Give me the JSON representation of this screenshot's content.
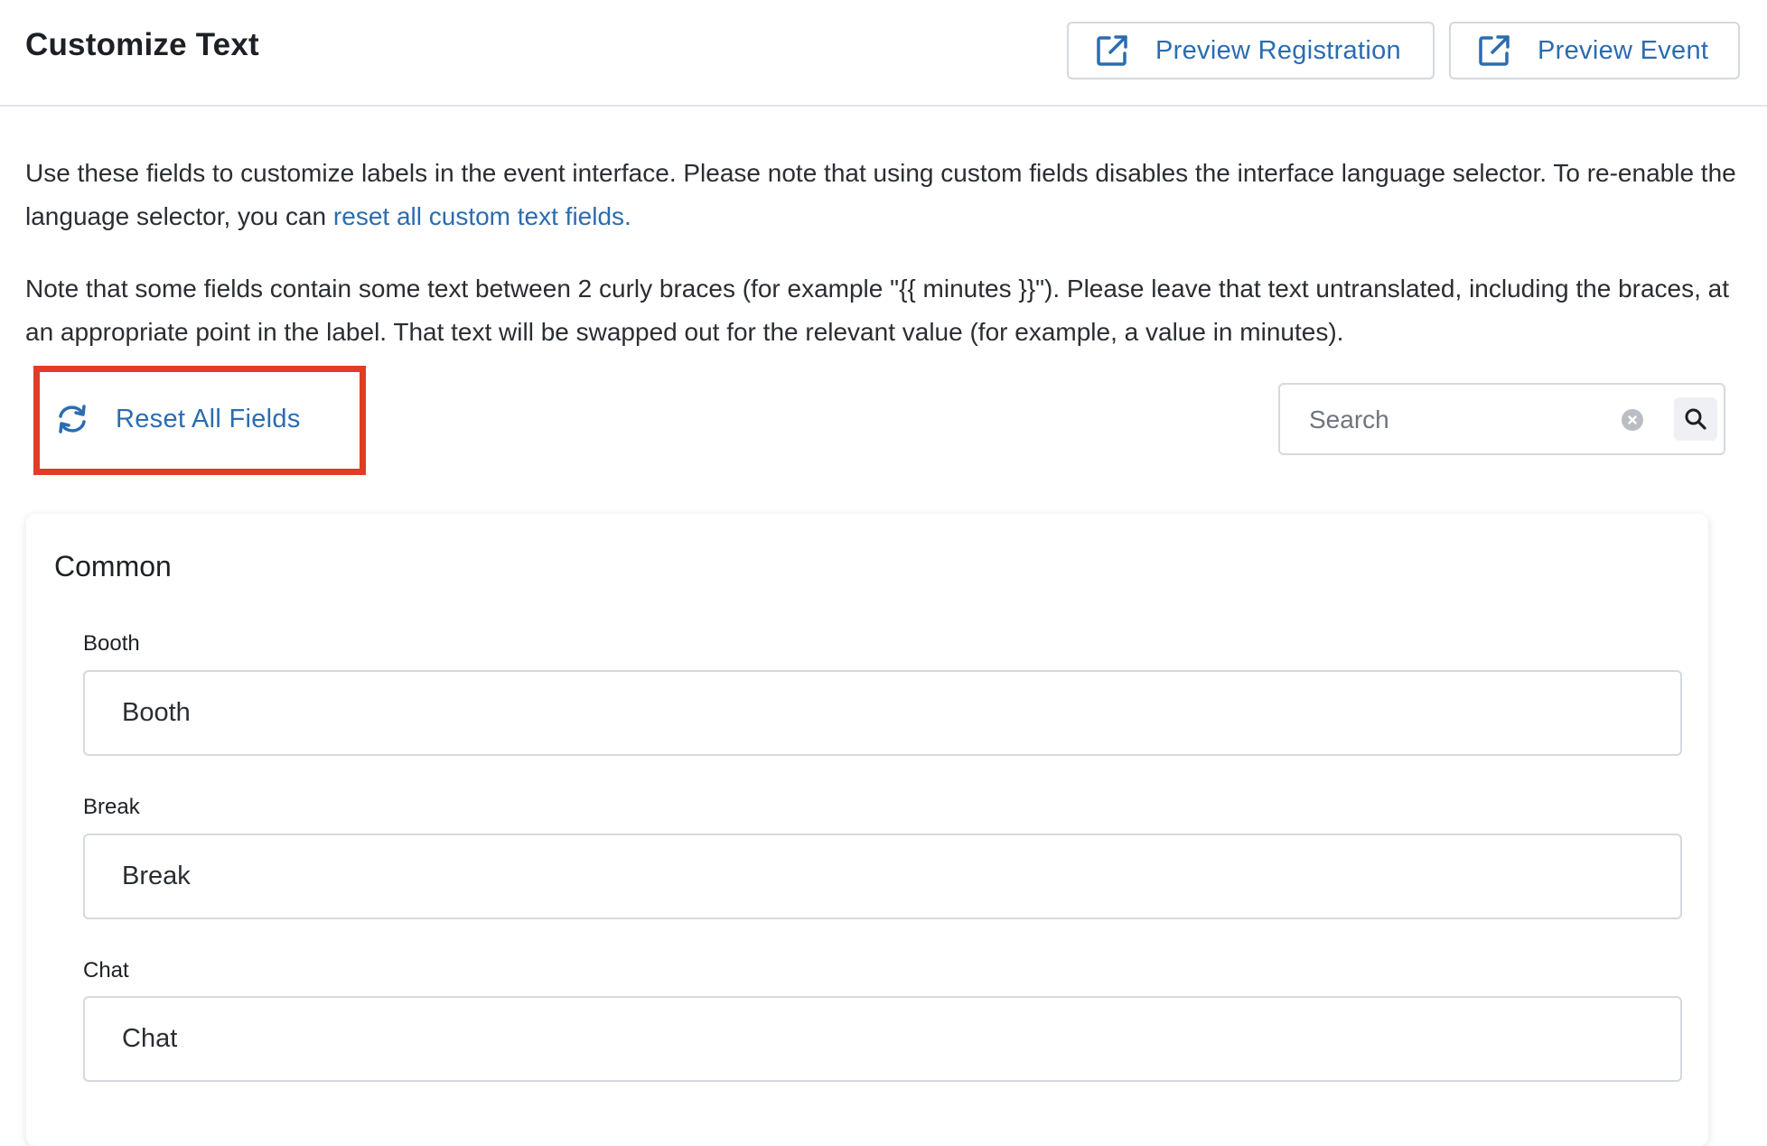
{
  "header": {
    "title": "Customize Text",
    "preview_registration_label": "Preview Registration",
    "preview_event_label": "Preview Event",
    "accent_color": "#2b6cb0"
  },
  "intro": {
    "paragraph1_text": "Use these fields to customize labels in the event interface. Please note that using custom fields disables the interface language selector. To re-enable the language selector, you can ",
    "paragraph1_link": "reset all custom text fields.",
    "paragraph2_text": "Note that some fields contain some text between 2 curly braces (for example \"{{ minutes }}\"). Please leave that text untranslated, including the braces, at an appropriate point in the label. That text will be swapped out for the relevant value (for example, a value in minutes)."
  },
  "toolbar": {
    "reset_label": "Reset All Fields",
    "highlight_color": "#e23b27",
    "search": {
      "placeholder": "Search",
      "value": ""
    }
  },
  "section": {
    "title": "Common",
    "fields": [
      {
        "label": "Booth",
        "value": "Booth"
      },
      {
        "label": "Break",
        "value": "Break"
      },
      {
        "label": "Chat",
        "value": "Chat"
      }
    ]
  }
}
